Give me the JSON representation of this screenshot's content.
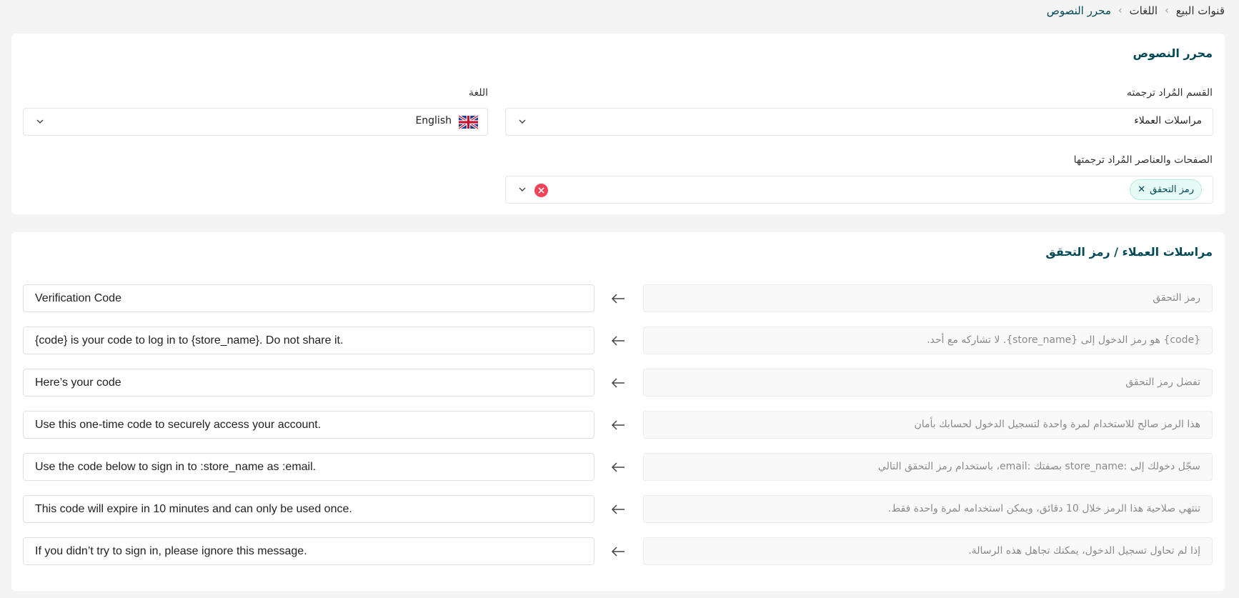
{
  "breadcrumb": {
    "items": [
      "قنوات البيع",
      "اللغات",
      "محرر النصوص"
    ]
  },
  "editor_card": {
    "title": "محرر النصوص",
    "section_label": "القسم المُراد ترجمته",
    "section_value": "مراسلات العملاء",
    "language_label": "اللغة",
    "language_value": "English",
    "language_flag_icon": "uk-flag-icon",
    "pages_label": "الصفحات والعناصر المُراد ترجمتها",
    "pages_chip": "رمز التحقق"
  },
  "translations_card": {
    "title": "مراسلات العملاء / رمز التحقق",
    "rows": [
      {
        "source": "رمز التحقق",
        "translation": "Verification Code"
      },
      {
        "source": "{code} هو رمز الدخول إلى {store_name}. لا تشاركه مع أحد.",
        "translation": "{code} is your code to log in to {store_name}. Do not share it."
      },
      {
        "source": "تفضل رمز التحقق",
        "translation": "Here’s your code"
      },
      {
        "source": "هذا الرمز صالح للاستخدام لمرة واحدة لتسجيل الدخول لحسابك بأمان",
        "translation": "Use this one-time code to securely access your account."
      },
      {
        "source": "سجّل دخولك إلى :store_name بصفتك :email، باستخدام رمز التحقق التالي",
        "translation": "Use the code below to sign in to :store_name as :email."
      },
      {
        "source": "تنتهي صلاحية هذا الرمز خلال 10 دقائق، ويمكن استخدامه لمرة واحدة فقط.",
        "translation": "This code will expire in 10 minutes and can only be used once."
      },
      {
        "source": "إذا لم تحاول تسجيل الدخول، يمكنك تجاهل هذه الرسالة.",
        "translation": "If you didn’t try to sign in, please ignore this message."
      }
    ]
  },
  "colors": {
    "accent": "#004956",
    "chip_bg": "#e6fbf6",
    "clear_red": "#f0425b"
  }
}
